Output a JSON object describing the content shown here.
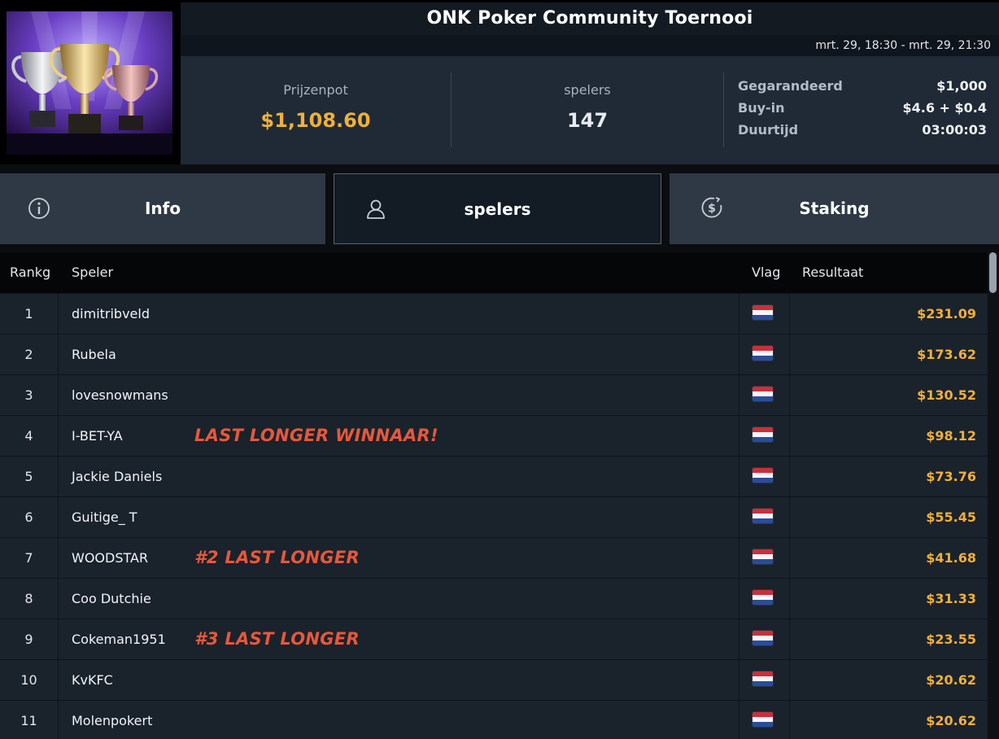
{
  "header": {
    "title": "ONK Poker Community Toernooi",
    "date_range": "mrt. 29, 18:30 - mrt. 29, 21:30",
    "trophy_icon": "trophy-cups-image"
  },
  "stats": {
    "prize_label": "Prijzenpot",
    "prize_value": "$1,108.60",
    "players_label": "spelers",
    "players_value": "147",
    "details": [
      {
        "key": "Gegarandeerd",
        "value": "$1,000"
      },
      {
        "key": "Buy-in",
        "value": "$4.6 + $0.4"
      },
      {
        "key": "Duurtijd",
        "value": "03:00:03"
      }
    ]
  },
  "tabs": [
    {
      "label": "Info",
      "icon": "info-icon",
      "active": false
    },
    {
      "label": "spelers",
      "icon": "user-icon",
      "active": true
    },
    {
      "label": "Staking",
      "icon": "dollar-coin-icon",
      "active": false
    }
  ],
  "table": {
    "headers": {
      "rank": "Rankg",
      "player": "Speler",
      "flag": "Vlag",
      "result": "Resultaat"
    },
    "rows": [
      {
        "rank": "1",
        "player": "dimitribveld",
        "note": "",
        "flag": "NL",
        "result": "$231.09"
      },
      {
        "rank": "2",
        "player": "Rubela",
        "note": "",
        "flag": "NL",
        "result": "$173.62"
      },
      {
        "rank": "3",
        "player": "lovesnowmans",
        "note": "",
        "flag": "NL",
        "result": "$130.52"
      },
      {
        "rank": "4",
        "player": "I-BET-YA",
        "note": "LAST LONGER WINNAAR!",
        "flag": "NL",
        "result": "$98.12"
      },
      {
        "rank": "5",
        "player": "Jackie Daniels",
        "note": "",
        "flag": "NL",
        "result": "$73.76"
      },
      {
        "rank": "6",
        "player": "Guitige_ T",
        "note": "",
        "flag": "NL",
        "result": "$55.45"
      },
      {
        "rank": "7",
        "player": "WOODSTAR",
        "note": "#2 LAST LONGER",
        "flag": "NL",
        "result": "$41.68"
      },
      {
        "rank": "8",
        "player": "Coo Dutchie",
        "note": "",
        "flag": "NL",
        "result": "$31.33"
      },
      {
        "rank": "9",
        "player": "Cokeman1951",
        "note": "#3 LAST LONGER",
        "flag": "NL",
        "result": "$23.55"
      },
      {
        "rank": "10",
        "player": "KvKFC",
        "note": "",
        "flag": "NL",
        "result": "$20.62"
      },
      {
        "rank": "11",
        "player": "Molenpokert",
        "note": "",
        "flag": "NL",
        "result": "$20.62"
      }
    ]
  },
  "colors": {
    "accent_gold": "#f0b03a",
    "annotation_red": "#e6583a",
    "row_bg": "#1a222c",
    "stats_bg": "#1f2a36"
  }
}
